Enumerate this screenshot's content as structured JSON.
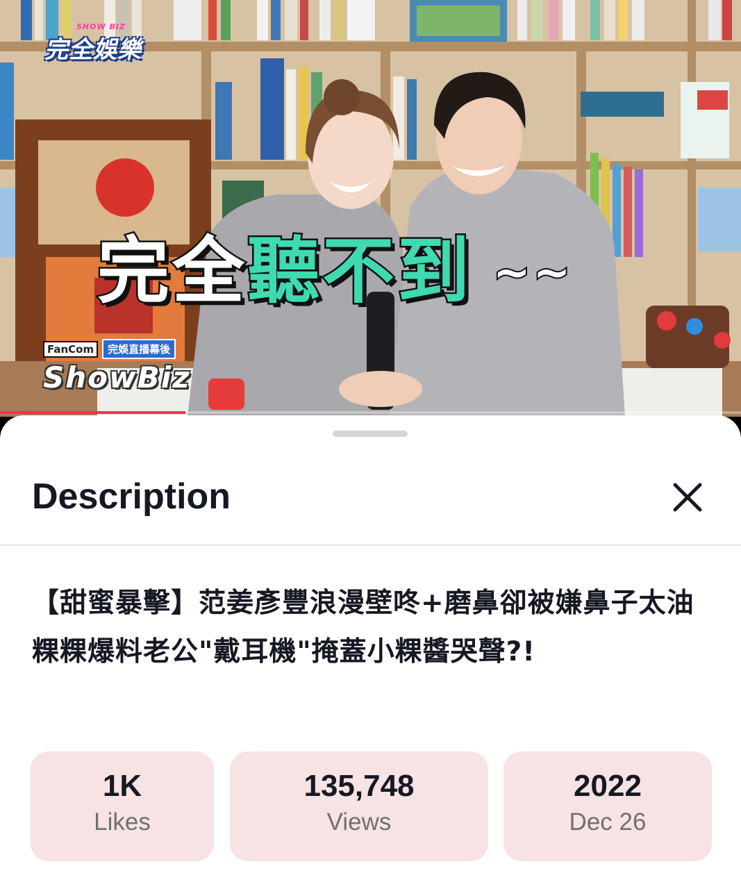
{
  "video": {
    "show_logo": "完全娛樂",
    "show_logo_small": "SHOW BIZ",
    "caption_white_1": "完",
    "caption_white_2": "全",
    "caption_green_1": "聽",
    "caption_green_2": "不",
    "caption_green_3": "到",
    "caption_tilde": "~~",
    "fancom_tag": "FanCom",
    "fancom_sub": "完娛直播幕後",
    "fancom_brand": "ShowBiz",
    "progress_fraction": 0.25,
    "colors": {
      "caption_green": "#3fd9b2",
      "progress": "#fe2c55"
    }
  },
  "sheet": {
    "title": "Description",
    "close_icon": "close-icon",
    "description": "【甜蜜暴擊】范姜彥豐浪漫壁咚+磨鼻卻被嫌鼻子太油 粿粿爆料老公\"戴耳機\"掩蓋小粿醬哭聲?!",
    "stats": [
      {
        "value": "1K",
        "label": "Likes"
      },
      {
        "value": "135,748",
        "label": "Views"
      },
      {
        "value": "2022",
        "label": "Dec 26"
      }
    ],
    "colors": {
      "stat_bg": "#f7e3e3",
      "title": "#161823",
      "label": "#6f6f75"
    }
  }
}
